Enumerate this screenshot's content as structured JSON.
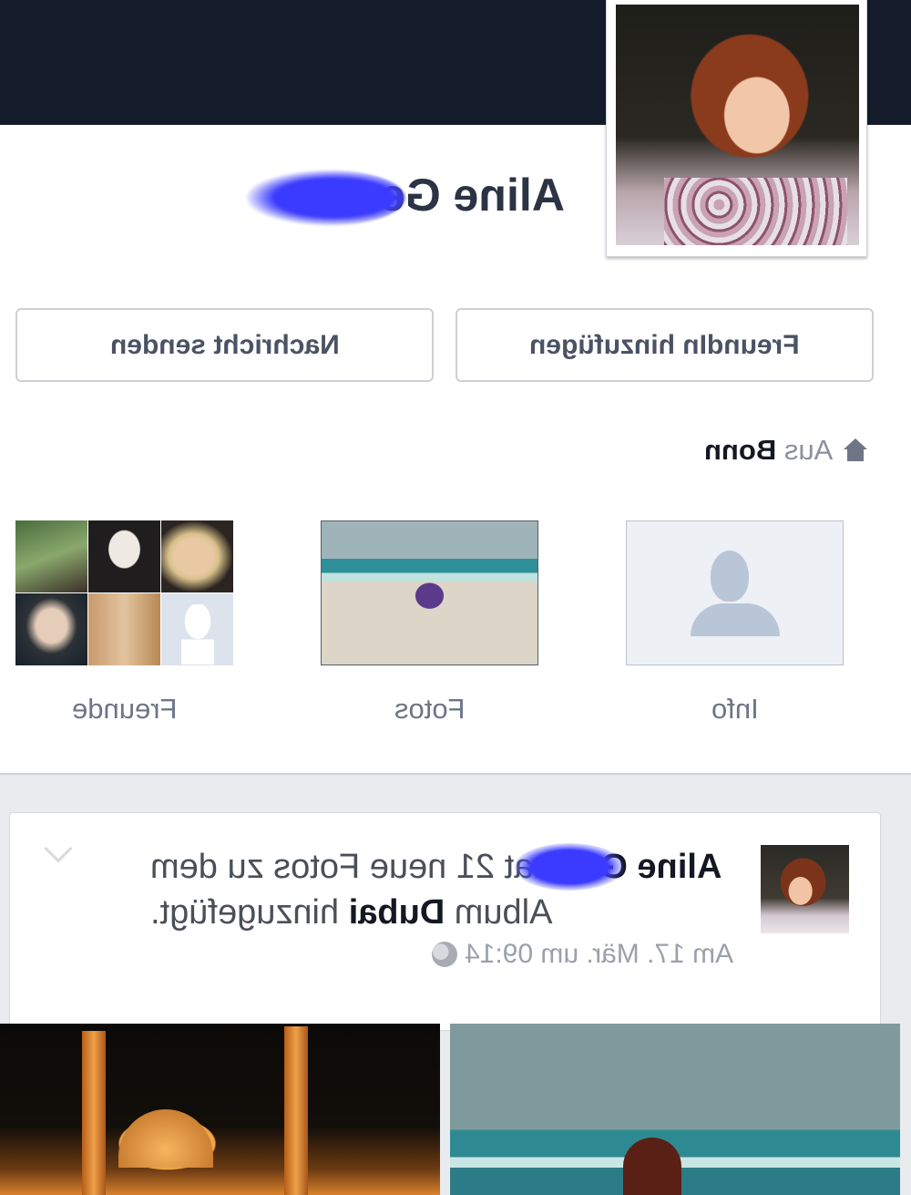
{
  "profile": {
    "name": "Aline Gell",
    "name_visible": "Aline Ge"
  },
  "actions": {
    "add_friend_label": "FreundIn hinzufügen",
    "message_label": "Nachricht senden"
  },
  "location": {
    "prefix": "Aus",
    "city": "Bonn"
  },
  "tiles": {
    "friends_label": "Freunde",
    "photos_label": "Fotos",
    "info_label": "Info"
  },
  "story": {
    "actor": "Aline Gell",
    "verb": "hat 21 neue Fotos zu dem Album",
    "album": "Dubai",
    "suffix": "hinzugefügt.",
    "time": "Am 17. Mär. um 09:14"
  },
  "colors": {
    "cover": "#141c2c",
    "scribble": "#3b3bff",
    "button_text": "#4b5264"
  },
  "icons": {
    "home": "home-icon",
    "privacy": "globe-icon",
    "menu": "chevron-down-icon"
  }
}
